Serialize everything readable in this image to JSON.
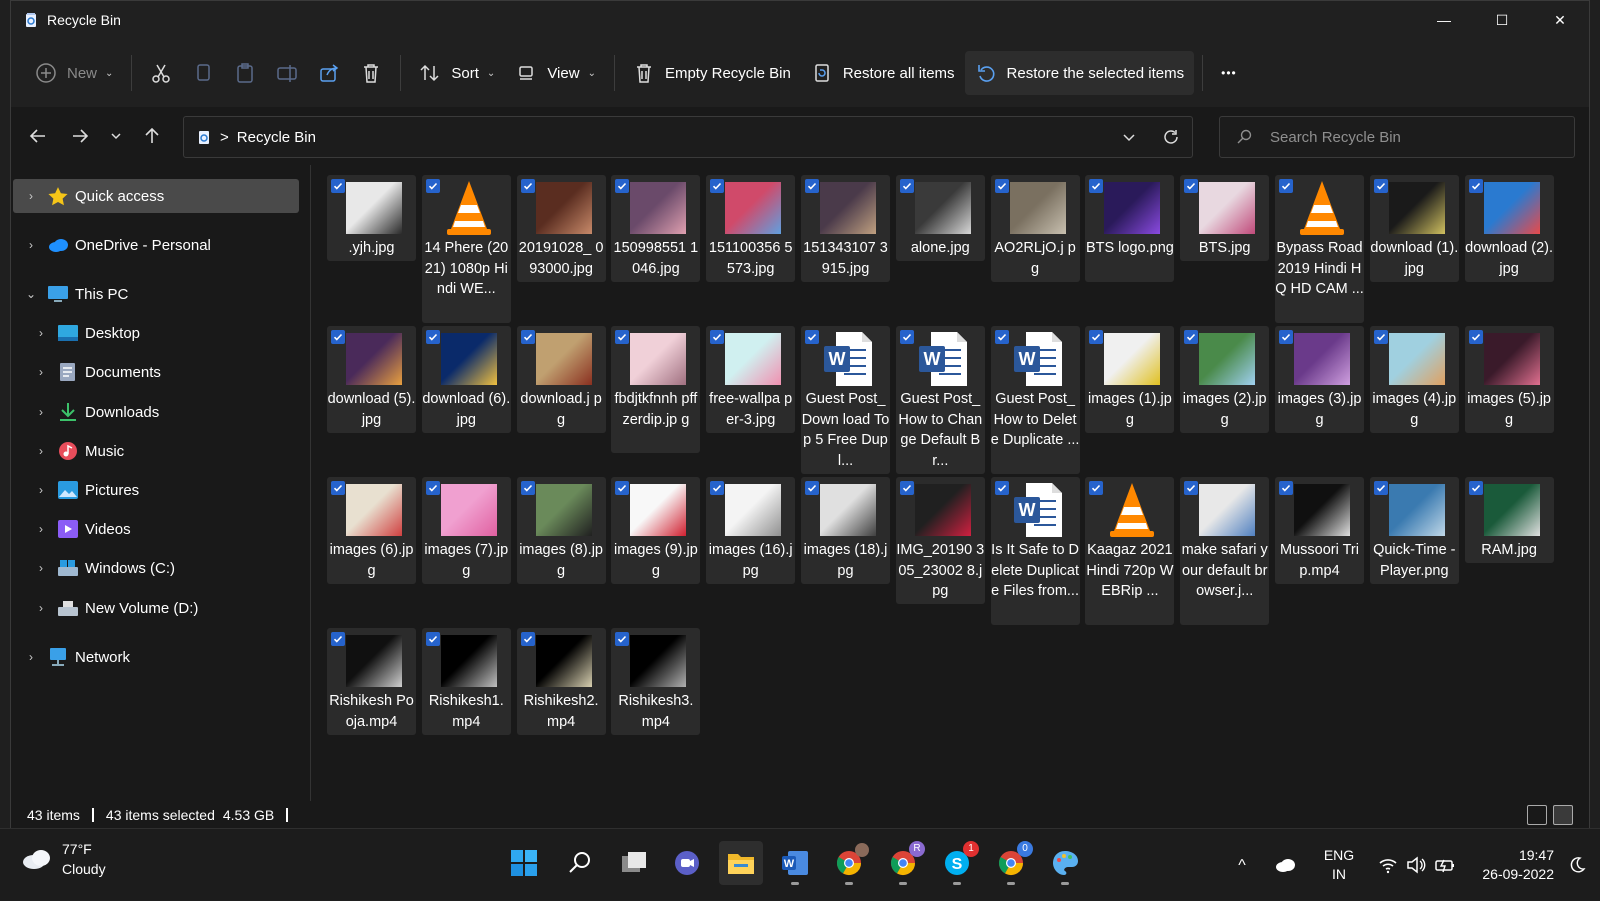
{
  "window": {
    "title": "Recycle Bin",
    "minimize": "—",
    "maximize": "☐",
    "close": "✕"
  },
  "toolbar": {
    "new_label": "New",
    "sort_label": "Sort",
    "view_label": "View",
    "empty_label": "Empty Recycle Bin",
    "restore_all_label": "Restore all items",
    "restore_selected_label": "Restore the selected items",
    "more_label": "•••"
  },
  "navbar": {
    "path_separator": ">",
    "location": "Recycle Bin",
    "search_placeholder": "Search Recycle Bin"
  },
  "sidebar": {
    "items": [
      {
        "label": "Quick access",
        "icon": "star-icon",
        "color": "#f5c518"
      },
      {
        "label": "OneDrive - Personal",
        "icon": "cloud-icon",
        "color": "#1e90ff"
      },
      {
        "label": "This PC",
        "icon": "monitor-icon",
        "color": "#3aa0e8"
      },
      {
        "label": "Desktop",
        "icon": "desktop-icon",
        "color": "#2fa8e0"
      },
      {
        "label": "Documents",
        "icon": "documents-icon",
        "color": "#9aa8c0"
      },
      {
        "label": "Downloads",
        "icon": "download-icon",
        "color": "#3cc26a"
      },
      {
        "label": "Music",
        "icon": "music-icon",
        "color": "#e84d5b"
      },
      {
        "label": "Pictures",
        "icon": "pictures-icon",
        "color": "#2a9be0"
      },
      {
        "label": "Videos",
        "icon": "videos-icon",
        "color": "#8b5cf6"
      },
      {
        "label": "Windows (C:)",
        "icon": "drive-c-icon",
        "color": "#9fb8d0"
      },
      {
        "label": "New Volume (D:)",
        "icon": "drive-d-icon",
        "color": "#b8c4d0"
      },
      {
        "label": "Network",
        "icon": "network-icon",
        "color": "#3aa0e8"
      }
    ]
  },
  "files": [
    {
      "name": ".yjh.jpg",
      "kind": "img",
      "colors": [
        "#e8e8e8",
        "#2a2a2a"
      ]
    },
    {
      "name": "14 Phere (2021) 1080p Hindi WE...",
      "kind": "vlc"
    },
    {
      "name": "20191028_ 093000.jpg",
      "kind": "img",
      "colors": [
        "#5a2d20",
        "#c88a6a"
      ]
    },
    {
      "name": "150998551 1046.jpg",
      "kind": "img",
      "colors": [
        "#6a4a6a",
        "#e0a0b0"
      ]
    },
    {
      "name": "151100356 5573.jpg",
      "kind": "img",
      "colors": [
        "#d04a6a",
        "#60a0e0"
      ]
    },
    {
      "name": "151343107 3915.jpg",
      "kind": "img",
      "colors": [
        "#4a3a4a",
        "#c0a080"
      ]
    },
    {
      "name": "alone.jpg",
      "kind": "img",
      "colors": [
        "#3a3a3a",
        "#d8d8d8"
      ]
    },
    {
      "name": "AO2RLjO.j pg",
      "kind": "img",
      "colors": [
        "#7a7060",
        "#c8c0b0"
      ]
    },
    {
      "name": "BTS logo.png",
      "kind": "img",
      "colors": [
        "#2a1a5a",
        "#8a4ae0"
      ]
    },
    {
      "name": "BTS.jpg",
      "kind": "img",
      "colors": [
        "#e8d8e0",
        "#c04a7a"
      ]
    },
    {
      "name": "Bypass Road 2019 Hindi HQ HD CAM ...",
      "kind": "vlc"
    },
    {
      "name": "download (1).jpg",
      "kind": "img",
      "colors": [
        "#1a1a1a",
        "#d0c060"
      ]
    },
    {
      "name": "download (2).jpg",
      "kind": "img",
      "colors": [
        "#2a7ad0",
        "#e84a4a"
      ]
    },
    {
      "name": "download (5).jpg",
      "kind": "img",
      "colors": [
        "#4a2a5a",
        "#e8a040"
      ]
    },
    {
      "name": "download (6).jpg",
      "kind": "img",
      "colors": [
        "#0a2a6a",
        "#f0c040"
      ]
    },
    {
      "name": "download.j pg",
      "kind": "img",
      "colors": [
        "#c0a070",
        "#8a3020"
      ]
    },
    {
      "name": "fbdjtkfnnh pffzerdip.jp g",
      "kind": "img",
      "colors": [
        "#f0d0d8",
        "#a07080"
      ]
    },
    {
      "name": "free-wallpa per-3.jpg",
      "kind": "img",
      "colors": [
        "#d0f0f0",
        "#f090b0"
      ]
    },
    {
      "name": "Guest Post_Down load Top 5 Free Dupl...",
      "kind": "word"
    },
    {
      "name": "Guest Post_How to Change Default Br...",
      "kind": "word"
    },
    {
      "name": "Guest Post_How to Delete Duplicate ...",
      "kind": "word"
    },
    {
      "name": "images (1).jpg",
      "kind": "img",
      "colors": [
        "#f0f0f0",
        "#e0c020"
      ]
    },
    {
      "name": "images (2).jpg",
      "kind": "img",
      "colors": [
        "#4a8a4a",
        "#a0d0f0"
      ]
    },
    {
      "name": "images (3).jpg",
      "kind": "img",
      "colors": [
        "#6a3a8a",
        "#d0a0e0"
      ]
    },
    {
      "name": "images (4).jpg",
      "kind": "img",
      "colors": [
        "#a0d0e0",
        "#e0a060"
      ]
    },
    {
      "name": "images (5).jpg",
      "kind": "img",
      "colors": [
        "#3a1a2a",
        "#e07090"
      ]
    },
    {
      "name": "images (6).jpg",
      "kind": "img",
      "colors": [
        "#e8e0d0",
        "#d04040"
      ]
    },
    {
      "name": "images (7).jpg",
      "kind": "img",
      "colors": [
        "#f0a0d0",
        "#e060a0"
      ]
    },
    {
      "name": "images (8).jpg",
      "kind": "img",
      "colors": [
        "#6a8a5a",
        "#202020"
      ]
    },
    {
      "name": "images (9).jpg",
      "kind": "img",
      "colors": [
        "#f8f8f8",
        "#d02030"
      ]
    },
    {
      "name": "images (16).jpg",
      "kind": "img",
      "colors": [
        "#f4f4f4",
        "#909090"
      ]
    },
    {
      "name": "images (18).jpg",
      "kind": "img",
      "colors": [
        "#e0e0e0",
        "#404040"
      ]
    },
    {
      "name": "IMG_20190 305_23002 8.jpg",
      "kind": "img",
      "colors": [
        "#202020",
        "#d02040"
      ]
    },
    {
      "name": "Is It Safe to Delete Duplicate Files from...",
      "kind": "word"
    },
    {
      "name": "Kaagaz 2021 Hindi 720p WEBRip ...",
      "kind": "vlc"
    },
    {
      "name": "make safari your default browser.j...",
      "kind": "img",
      "colors": [
        "#e8e8e8",
        "#5080c0"
      ]
    },
    {
      "name": "Mussoori Trip.mp4",
      "kind": "img",
      "colors": [
        "#101010",
        "#e0e0e0"
      ]
    },
    {
      "name": "Quick-Time -Player.png",
      "kind": "img",
      "colors": [
        "#3a7ab0",
        "#c0d8e8"
      ]
    },
    {
      "name": "RAM.jpg",
      "kind": "img",
      "colors": [
        "#1a5a3a",
        "#e0e0e0"
      ]
    },
    {
      "name": "Rishikesh Pooja.mp4",
      "kind": "img",
      "colors": [
        "#101010",
        "#d0d0d0"
      ]
    },
    {
      "name": "Rishikesh1. mp4",
      "kind": "img",
      "colors": [
        "#000000",
        "#c0c0c0"
      ]
    },
    {
      "name": "Rishikesh2. mp4",
      "kind": "img",
      "colors": [
        "#000000",
        "#d8d0b0"
      ]
    },
    {
      "name": "Rishikesh3. mp4",
      "kind": "img",
      "colors": [
        "#000000",
        "#b0b0b0"
      ]
    }
  ],
  "status": {
    "count": "43 items",
    "selected": "43 items selected",
    "size": "4.53 GB"
  },
  "taskbar": {
    "weather_temp": "77°F",
    "weather_desc": "Cloudy",
    "lang_top": "ENG",
    "lang_bottom": "IN",
    "time": "19:47",
    "date": "26-09-2022",
    "badge_r": "R",
    "badge_s": "1",
    "badge_0": "0",
    "tray_overflow": "^"
  },
  "colors": {
    "accent": "#2663cc",
    "selected_bg": "#4a4a4a",
    "tile_bg": "#2b2b2b"
  }
}
